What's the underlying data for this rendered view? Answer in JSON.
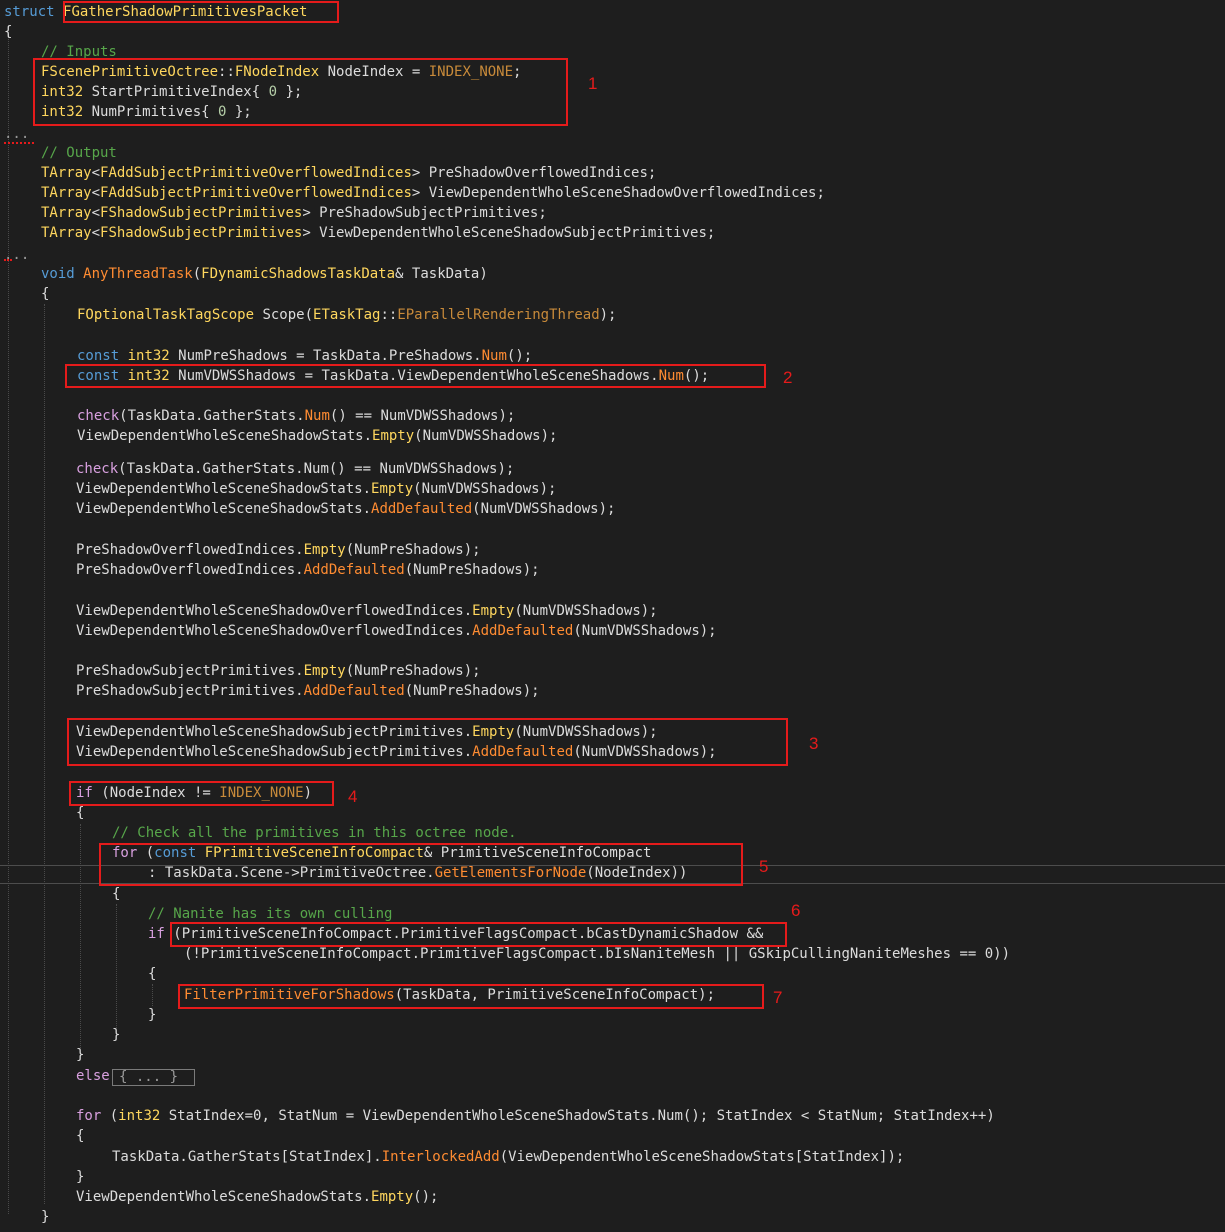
{
  "code": {
    "struct_kw": "struct",
    "struct_name": "FGatherShadowPrimitivesPacket",
    "open_brace": "{",
    "comment_inputs": "// Inputs",
    "l1_type": "FScenePrimitiveOctree",
    "l1_scope": "::",
    "l1_type2": "FNodeIndex",
    "l1_var": " NodeIndex = ",
    "l1_const": "INDEX_NONE",
    "l1_end": ";",
    "l2_type": "int32",
    "l2_rest": " StartPrimitiveIndex{ ",
    "l2_num": "0",
    "l2_end": " };",
    "l3_type": "int32",
    "l3_rest": " NumPrimitives{ ",
    "l3_num": "0",
    "l3_end": " };",
    "ellipsis1": "...",
    "comment_output": "// Output",
    "o1_tarray": "TArray",
    "o1_lt": "<",
    "o1_type": "FAddSubjectPrimitiveOverflowedIndices",
    "o1_rest": "> PreShadowOverflowedIndices;",
    "o2_tarray": "TArray",
    "o2_lt": "<",
    "o2_type": "FAddSubjectPrimitiveOverflowedIndices",
    "o2_rest": "> ViewDependentWholeSceneShadowOverflowedIndices;",
    "o3_tarray": "TArray",
    "o3_lt": "<",
    "o3_type": "FShadowSubjectPrimitives",
    "o3_rest": "> PreShadowSubjectPrimitives;",
    "o4_tarray": "TArray",
    "o4_lt": "<",
    "o4_type": "FShadowSubjectPrimitives",
    "o4_rest": "> ViewDependentWholeSceneShadowSubjectPrimitives;",
    "ellipsis2": "...",
    "fn_void": "void",
    "fn_name": "AnyThreadTask",
    "fn_open": "(",
    "fn_ptype": "FDynamicShadowsTaskData",
    "fn_prest": "& TaskData)",
    "fn_brace": "{",
    "s1_type": "FOptionalTaskTagScope",
    "s1_mid": " Scope(",
    "s1_type2": "ETaskTag",
    "s1_scope": "::",
    "s1_enum": "EParallelRenderingThread",
    "s1_end": ");",
    "c1_const": "const",
    "c1_type": "int32",
    "c1_mid": " NumPreShadows = TaskData.PreShadows.",
    "c1_fn": "Num",
    "c1_end": "();",
    "c2_const": "const",
    "c2_type": "int32",
    "c2_mid": " NumVDWSShadows = TaskData.ViewDependentWholeSceneShadows.",
    "c2_fn": "Num",
    "c2_end": "();",
    "k1_check": "check",
    "k1_mid": "(TaskData.GatherStats.",
    "k1_fn": "Num",
    "k1_end": "() == NumVDWSShadows);",
    "k2_var": "ViewDependentWholeSceneShadowStats.",
    "k2_fn": "Empty",
    "k2_end": "(NumVDWSShadows);",
    "k3_check": "check",
    "k3_rest": "(TaskData.GatherStats.Num() == NumVDWSShadows);",
    "k4_var": "ViewDependentWholeSceneShadowStats.",
    "k4_fn": "Empty",
    "k4_end": "(NumVDWSShadows);",
    "k5_var": "ViewDependentWholeSceneShadowStats.",
    "k5_fn": "AddDefaulted",
    "k5_end": "(NumVDWSShadows);",
    "p1_var": "PreShadowOverflowedIndices.",
    "p1_fn": "Empty",
    "p1_end": "(NumPreShadows);",
    "p2_var": "PreShadowOverflowedIndices.",
    "p2_fn": "AddDefaulted",
    "p2_end": "(NumPreShadows);",
    "v1_var": "ViewDependentWholeSceneShadowOverflowedIndices.",
    "v1_fn": "Empty",
    "v1_end": "(NumVDWSShadows);",
    "v2_var": "ViewDependentWholeSceneShadowOverflowedIndices.",
    "v2_fn": "AddDefaulted",
    "v2_end": "(NumVDWSShadows);",
    "s2_var": "PreShadowSubjectPrimitives.",
    "s2_fn": "Empty",
    "s2_end": "(NumPreShadows);",
    "s3_var": "PreShadowSubjectPrimitives.",
    "s3_fn": "AddDefaulted",
    "s3_end": "(NumPreShadows);",
    "w1_var": "ViewDependentWholeSceneShadowSubjectPrimitives.",
    "w1_fn": "Empty",
    "w1_end": "(NumVDWSShadows);",
    "w2_var": "ViewDependentWholeSceneShadowSubjectPrimitives.",
    "w2_fn": "AddDefaulted",
    "w2_end": "(NumVDWSShadows);",
    "if1_kw": "if",
    "if1_mid": " (NodeIndex != ",
    "if1_const": "INDEX_NONE",
    "if1_end": ")",
    "if1_brace": "{",
    "cm_check": "// Check all the primitives in this octree node.",
    "for1_kw": "for",
    "for1_open": " (",
    "for1_const": "const",
    "for1_type": "FPrimitiveSceneInfoCompact",
    "for1_rest": "& PrimitiveSceneInfoCompact",
    "for2_colon": ": TaskData.Scene->PrimitiveOctree.",
    "for2_fn": "GetElementsForNode",
    "for2_end": "(NodeIndex))",
    "for_brace": "{",
    "cm_nanite": "// Nanite has its own culling",
    "if2_kw": "if",
    "if2_rest": " (PrimitiveSceneInfoCompact.PrimitiveFlagsCompact.bCastDynamicShadow &&",
    "if3_rest": "(!PrimitiveSceneInfoCompact.PrimitiveFlagsCompact.bIsNaniteMesh || GSkipCullingNaniteMeshes == 0))",
    "if2_brace": "{",
    "fp_fn": "FilterPrimitiveForShadows",
    "fp_end": "(TaskData, PrimitiveSceneInfoCompact);",
    "close_b1": "}",
    "close_b2": "}",
    "close_b3": "}",
    "else_kw": "else",
    "else_collapsed": "{ ... }",
    "for3_kw": "for",
    "for3_open": " (",
    "for3_type": "int32",
    "for3_rest": " StatIndex=0, StatNum = ViewDependentWholeSceneShadowStats.Num(); StatIndex < StatNum; StatIndex++)",
    "for3_brace": "{",
    "ia_var": "TaskData.GatherStats[StatIndex].",
    "ia_fn": "InterlockedAdd",
    "ia_end": "(ViewDependentWholeSceneShadowStats[StatIndex]);",
    "for3_close": "}",
    "fe_var": "ViewDependentWholeSceneShadowStats.",
    "fe_fn": "Empty",
    "fe_end": "();",
    "fn_close": "}"
  },
  "annotations": {
    "n1": "1",
    "n2": "2",
    "n3": "3",
    "n4": "4",
    "n5": "5",
    "n6": "6",
    "n7": "7"
  },
  "colors": {
    "background": "#1e1e1e",
    "keyword": "#569cd6",
    "control_flow": "#d8a0df",
    "type": "#ffd75e",
    "function": "#ff8c32",
    "comment": "#57a64a",
    "number": "#b5cea8",
    "annotation_red": "#e51b1b"
  }
}
